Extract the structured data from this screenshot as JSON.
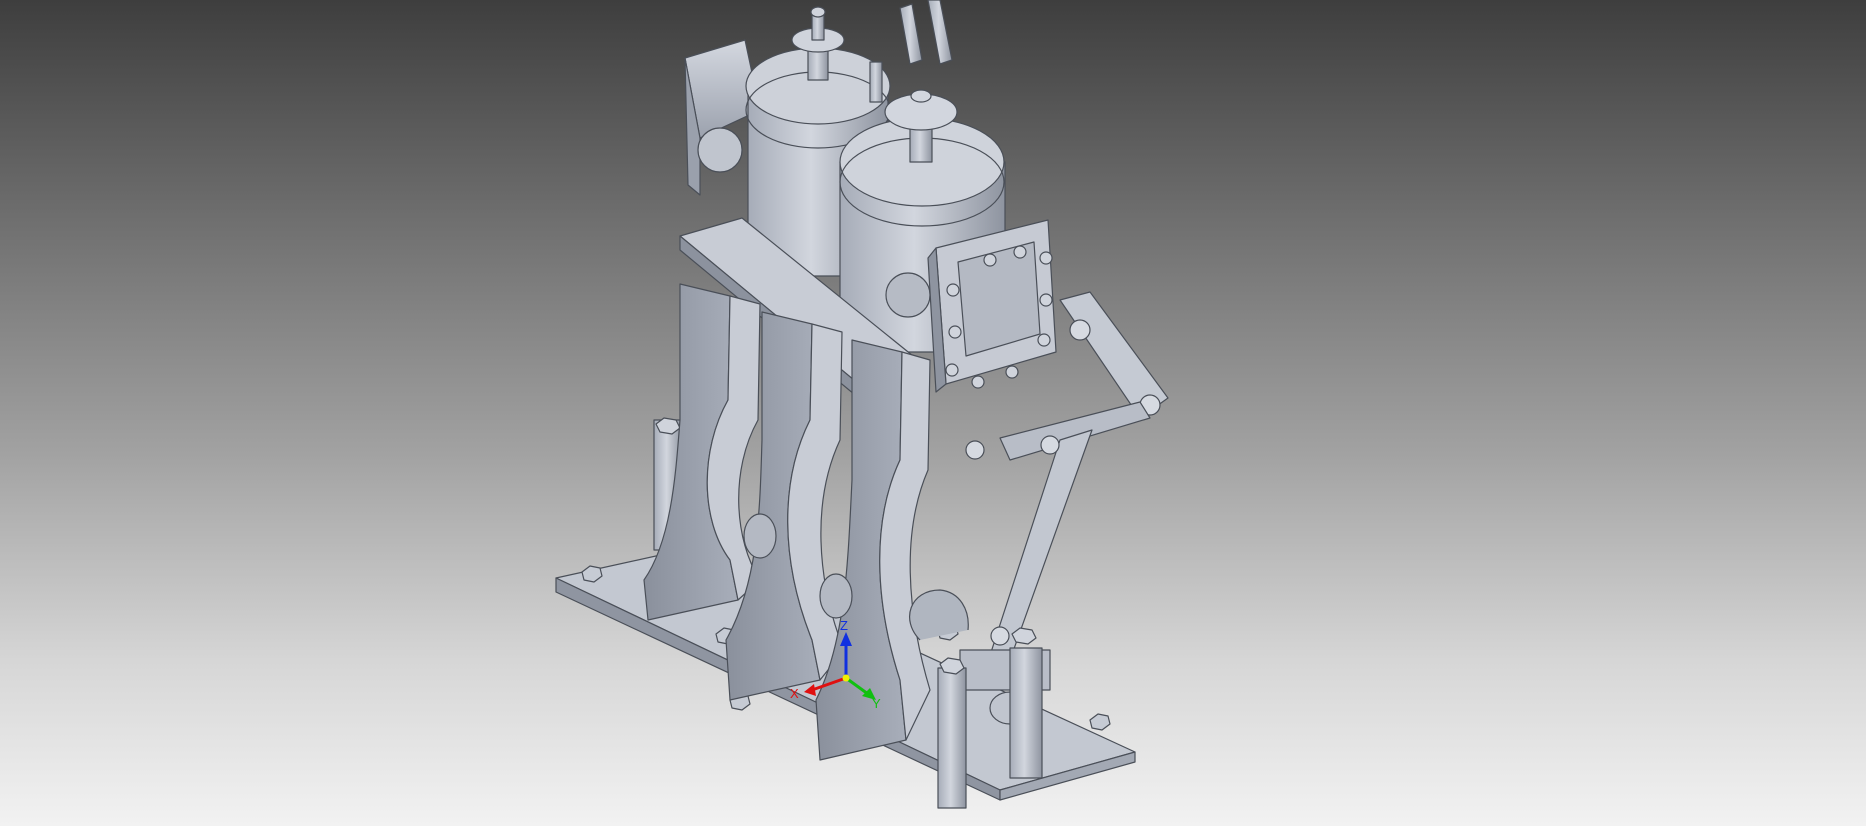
{
  "viewport": {
    "background_top": "#3e3e3e",
    "background_bottom": "#f2f2f2",
    "model_color": "#b9bec8"
  },
  "triad": {
    "x_label": "X",
    "y_label": "Y",
    "z_label": "Z",
    "x_color": "#e01010",
    "y_color": "#10c010",
    "z_color": "#1030e0",
    "origin_color": "#f0f000"
  }
}
